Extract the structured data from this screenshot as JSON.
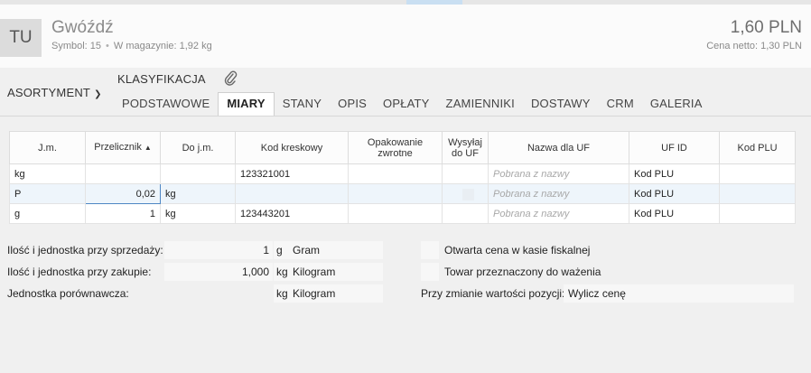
{
  "header": {
    "avatar": "TU",
    "name": "Gwóźdź",
    "symbol": "Symbol: 15",
    "stock": "W magazynie: 1,92 kg",
    "price": "1,60 PLN",
    "net_price": "Cena netto: 1,30 PLN"
  },
  "nav": {
    "asortyment": "ASORTYMENT",
    "klasyfikacja": "KLASYFIKACJA",
    "tabs": [
      "PODSTAWOWE",
      "MIARY",
      "STANY",
      "OPIS",
      "OPŁATY",
      "ZAMIENNIKI",
      "DOSTAWY",
      "CRM",
      "GALERIA"
    ],
    "active_tab": "MIARY"
  },
  "grid": {
    "headers": [
      "J.m.",
      "Przelicznik",
      "Do j.m.",
      "Kod kreskowy",
      "Opakowanie zwrotne",
      "Wysyłaj do UF",
      "Nazwa dla UF",
      "UF ID",
      "Kod PLU"
    ],
    "sorted_column": "Przelicznik",
    "rows": [
      {
        "jm": "kg",
        "przelicznik": "",
        "do_jm": "",
        "kod": "123321001",
        "nazwa_uf": "Pobrana z nazwy",
        "uf_id": "Kod PLU"
      },
      {
        "jm": "P",
        "przelicznik": "0,02",
        "do_jm": "kg",
        "kod": "",
        "nazwa_uf": "Pobrana z nazwy",
        "uf_id": "Kod PLU"
      },
      {
        "jm": "g",
        "przelicznik": "1",
        "do_jm": "kg",
        "kod": "123443201",
        "nazwa_uf": "Pobrana z nazwy",
        "uf_id": "Kod PLU"
      }
    ]
  },
  "form": {
    "sale_label": "Ilość i jednostka przy sprzedaży:",
    "sale_qty": "1",
    "sale_unit_code": "g",
    "sale_unit_name": "Gram",
    "purchase_label": "Ilość i jednostka przy zakupie:",
    "purchase_qty": "1,000",
    "purchase_unit_code": "kg",
    "purchase_unit_name": "Kilogram",
    "compare_label": "Jednostka porównawcza:",
    "compare_unit_code": "kg",
    "compare_unit_name": "Kilogram",
    "open_price_label": "Otwarta cena w kasie fiskalnej",
    "weighing_label": "Towar przeznaczony do ważenia",
    "change_label": "Przy zmianie wartości pozycji:",
    "change_value": "Wylicz cenę"
  },
  "icons": {
    "attach": "paperclip-icon",
    "sort": "sort-ascending-icon",
    "dropdown": "chevron-down-icon"
  },
  "colors": {
    "accent": "#4f87c4",
    "selected_row": "#eef5fb"
  }
}
